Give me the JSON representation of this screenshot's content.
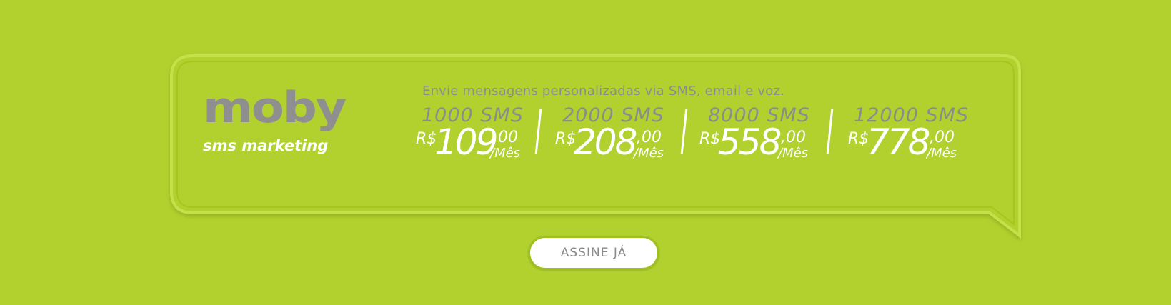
{
  "brand": {
    "logo_word": "moby",
    "logo_tagline": "sms marketing"
  },
  "headline": "Envie mensagens personalizadas via SMS, email e voz.",
  "plans": [
    {
      "name": "1000 SMS",
      "currency": "R$",
      "amount": "109",
      "cents": ",00",
      "period": "/Mês"
    },
    {
      "name": "2000 SMS",
      "currency": "R$",
      "amount": "208",
      "cents": ",00",
      "period": "/Mês"
    },
    {
      "name": "8000 SMS",
      "currency": "R$",
      "amount": "558",
      "cents": ",00",
      "period": "/Mês"
    },
    {
      "name": "12000 SMS",
      "currency": "R$",
      "amount": "778",
      "cents": ",00",
      "period": "/Mês"
    }
  ],
  "cta": {
    "label": "ASSINE JÁ"
  },
  "colors": {
    "background": "#b2d12f",
    "gray_text": "#8c8c8c",
    "white": "#ffffff"
  }
}
